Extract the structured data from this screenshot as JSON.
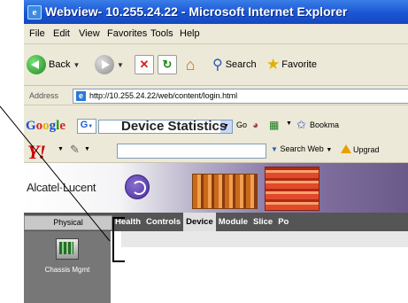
{
  "window": {
    "title": "Webview- 10.255.24.22 - Microsoft Internet Explorer"
  },
  "menu": {
    "items": [
      "File",
      "Edit",
      "View",
      "Favorites",
      "Tools",
      "Help"
    ]
  },
  "toolbar": {
    "back_label": "Back",
    "search_label": "Search",
    "favorites_label": "Favorite"
  },
  "address": {
    "label": "Address",
    "url": "http://10.255.24.22/web/content/login.html"
  },
  "google": {
    "logo": "Google",
    "go_label": "Go",
    "bookmarks_label": "Bookma"
  },
  "yahoo": {
    "logo": "Y!",
    "search_web_label": "Search Web",
    "upgrade_label": "Upgrad"
  },
  "app": {
    "brand": "Alcatel·Lucent",
    "physical_button": "Physical",
    "tabs": [
      {
        "label": "Health"
      },
      {
        "label": "Controls"
      },
      {
        "label": "Device"
      },
      {
        "label": "Module"
      },
      {
        "label": "Slice"
      },
      {
        "label": "Po"
      }
    ],
    "active_tab": "Device",
    "chassis_label": "Chassis Mgmt",
    "heading": "Device Statistics"
  }
}
